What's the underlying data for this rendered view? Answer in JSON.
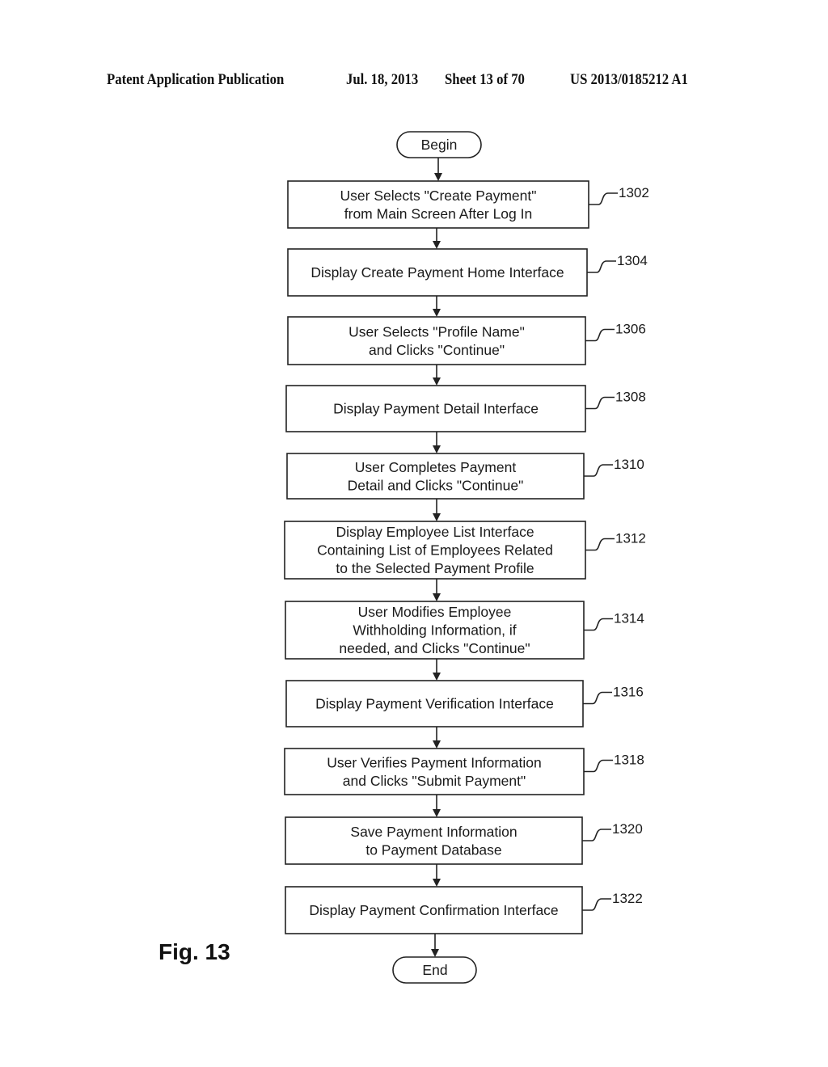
{
  "header": {
    "publication": "Patent Application Publication",
    "date": "Jul. 18, 2013",
    "sheet": "Sheet 13 of 70",
    "number": "US 2013/0185212 A1"
  },
  "figure_label": "Fig. 13",
  "flowchart": {
    "start": "Begin",
    "end": "End",
    "steps": [
      {
        "ref": "1302",
        "lines": [
          "User Selects \"Create Payment\"",
          "from Main Screen After Log In"
        ]
      },
      {
        "ref": "1304",
        "lines": [
          "Display Create Payment Home Interface"
        ]
      },
      {
        "ref": "1306",
        "lines": [
          "User Selects \"Profile Name\"",
          "and Clicks \"Continue\""
        ]
      },
      {
        "ref": "1308",
        "lines": [
          "Display Payment Detail Interface"
        ]
      },
      {
        "ref": "1310",
        "lines": [
          "User Completes Payment",
          "Detail and Clicks \"Continue\""
        ]
      },
      {
        "ref": "1312",
        "lines": [
          "Display Employee List Interface",
          "Containing List of Employees Related",
          "to the Selected Payment Profile"
        ]
      },
      {
        "ref": "1314",
        "lines": [
          "User Modifies Employee",
          "Withholding Information, if",
          "needed, and Clicks \"Continue\""
        ]
      },
      {
        "ref": "1316",
        "lines": [
          "Display Payment Verification Interface"
        ]
      },
      {
        "ref": "1318",
        "lines": [
          "User Verifies Payment Information",
          "and Clicks \"Submit Payment\""
        ]
      },
      {
        "ref": "1320",
        "lines": [
          "Save Payment Information",
          "to Payment Database"
        ]
      },
      {
        "ref": "1322",
        "lines": [
          "Display Payment Confirmation Interface"
        ]
      }
    ]
  }
}
